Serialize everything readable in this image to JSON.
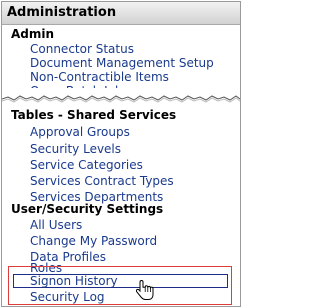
{
  "panel": {
    "title": "Administration",
    "sections": [
      {
        "title": "Admin",
        "items": [
          "Connector Status",
          "Document Management Setup",
          "Non-Contractible Items",
          "Open Batch Jobs"
        ]
      },
      {
        "title": "Tables - Shared Services",
        "items": [
          "Approval Groups",
          "Security Levels",
          "Service Categories",
          "Services Contract Types",
          "Services Departments"
        ]
      },
      {
        "title": "User/Security Settings",
        "items": [
          "All Users",
          "Change My Password",
          "Data Profiles",
          "Roles",
          "Signon History",
          "Security Log"
        ]
      }
    ]
  },
  "colors": {
    "link": "#1a3a8c",
    "highlight_box": "#e03c3c",
    "selection_border": "#1f2d8a"
  },
  "cursor": {
    "icon": "hand-pointer-icon"
  }
}
